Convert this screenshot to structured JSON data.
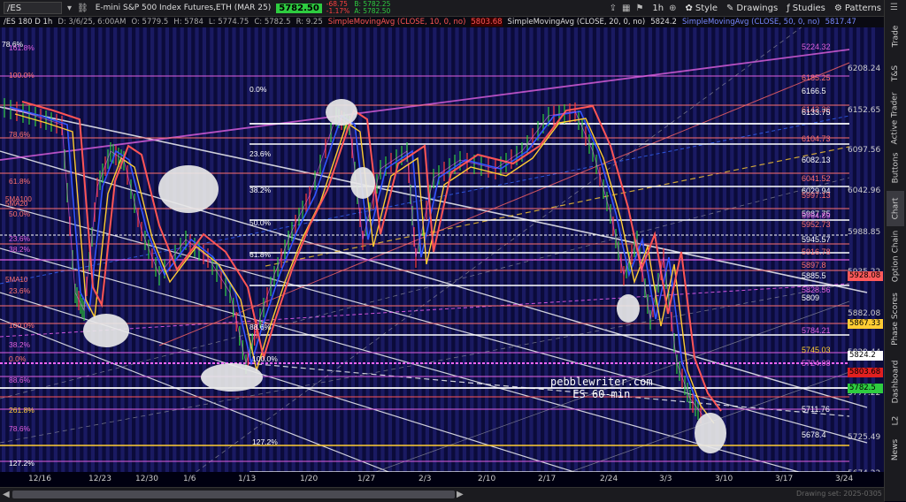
{
  "toolbar": {
    "symbol": "/ES",
    "description": "E-mini S&P 500 Index Futures,ETH (MAR 25)",
    "last_price": "5782.50",
    "change": "-68.75",
    "change_pct": "-1.17%",
    "bid": "B: 5782.25",
    "ask": "A: 5782.50",
    "timeframe": "1h",
    "style_label": "Style",
    "drawings_label": "Drawings",
    "studies_label": "Studies",
    "patterns_label": "Patterns",
    "colors": {
      "price_up": "#2ecc40",
      "change_down": "#ff4040"
    }
  },
  "infobar": {
    "period": "/ES 180 D 1h",
    "date": "D: 3/6/25, 6:00AM",
    "open": "O: 5779.5",
    "high": "H: 5784",
    "low": "L: 5774.75",
    "close": "C: 5782.5",
    "range": "R: 9.25",
    "sma10": "SimpleMovingAvg (CLOSE, 10, 0, no)",
    "sma10_val": "5803.68",
    "sma20": "SimpleMovingAvg (CLOSE, 20, 0, no)",
    "sma20_val": "5824.2",
    "sma50": "SimpleMovingAvg (CLOSE, 50, 0, no)",
    "sma50_val": "5817.47"
  },
  "watermark": {
    "line1": "pebblewriter.com",
    "line2": "ES 60-min"
  },
  "price_axis": [
    "6208.24",
    "6152.65",
    "6097.56",
    "6042.96",
    "5988.85",
    "5935.22",
    "5882.08",
    "5829.44",
    "5777.22",
    "5725.49",
    "5674.22"
  ],
  "x_axis": [
    "12/16",
    "12/23",
    "12/30",
    "1/6",
    "1/13",
    "1/20",
    "1/27",
    "2/3",
    "2/10",
    "2/17",
    "2/24",
    "3/3",
    "3/10",
    "3/17",
    "3/24"
  ],
  "level_labels": [
    {
      "text": "5224.32",
      "color": "#e060e0"
    },
    {
      "text": "6185.25",
      "color": "#ff7070"
    },
    {
      "text": "6166.5",
      "color": "#ffffff"
    },
    {
      "text": "6142.36",
      "color": "#ff7070"
    },
    {
      "text": "6133.75",
      "color": "#ffffff"
    },
    {
      "text": "6104.73",
      "color": "#ff7070"
    },
    {
      "text": "6082.13",
      "color": "#ffffff"
    },
    {
      "text": "6041.52",
      "color": "#ff7070"
    },
    {
      "text": "6029.94",
      "color": "#ffffff"
    },
    {
      "text": "5997.13",
      "color": "#ff7070"
    },
    {
      "text": "5987.75",
      "color": "#ffffff"
    },
    {
      "text": "5964.89",
      "color": "#e060e0"
    },
    {
      "text": "5952.73",
      "color": "#ff7070"
    },
    {
      "text": "5945.57",
      "color": "#ffffff"
    },
    {
      "text": "5916.78",
      "color": "#ff7070"
    },
    {
      "text": "5897.8",
      "color": "#ff7070"
    },
    {
      "text": "5885.5",
      "color": "#ffffff"
    },
    {
      "text": "5828.56",
      "color": "#e060e0"
    },
    {
      "text": "5809",
      "color": "#ffffff"
    },
    {
      "text": "5784.21",
      "color": "#e060e0"
    },
    {
      "text": "5745.03",
      "color": "#ffcc33"
    },
    {
      "text": "5724.08",
      "color": "#e060e0"
    },
    {
      "text": "5711.76",
      "color": "#ffffff"
    },
    {
      "text": "5678.4",
      "color": "#ffffff"
    }
  ],
  "fib_labels": [
    {
      "text": "0.0%",
      "color": "#ffffff"
    },
    {
      "text": "23.6%",
      "color": "#ffffff"
    },
    {
      "text": "38.2%",
      "color": "#ffffff"
    },
    {
      "text": "50.0%",
      "color": "#ffffff"
    },
    {
      "text": "61.8%",
      "color": "#ffffff"
    },
    {
      "text": "78.6%",
      "color": "#ffffff"
    },
    {
      "text": "88.6%",
      "color": "#ffffff"
    },
    {
      "text": "100.0%",
      "color": "#ffffff"
    },
    {
      "text": "127.2%",
      "color": "#ffffff"
    },
    {
      "text": "161.8%",
      "color": "#e060e0"
    },
    {
      "text": "100.0%",
      "color": "#ff7070"
    },
    {
      "text": "78.6%",
      "color": "#ff7070"
    },
    {
      "text": "61.8%",
      "color": "#ff7070"
    },
    {
      "text": "50.0%",
      "color": "#ff7070"
    },
    {
      "text": "23.6%",
      "color": "#e060e0"
    },
    {
      "text": "38.2%",
      "color": "#e060e0"
    },
    {
      "text": "23.6%",
      "color": "#ff7070"
    },
    {
      "text": "100.0%",
      "color": "#ff7070"
    },
    {
      "text": "38.2%",
      "color": "#e060e0"
    },
    {
      "text": "0.0%",
      "color": "#ff7070"
    },
    {
      "text": "88.6%",
      "color": "#e060e0"
    },
    {
      "text": "261.8%",
      "color": "#ffcc33"
    },
    {
      "text": "78.6%",
      "color": "#e060e0"
    },
    {
      "text": "127.2%",
      "color": "#ffffff"
    }
  ],
  "ma_labels": [
    "5MA100",
    "5MA20",
    "5MA10"
  ],
  "right_tags": [
    {
      "text": "5928.08",
      "bg": "#ff5a5a",
      "fg": "#000000"
    },
    {
      "text": "5867.33",
      "bg": "#ffcc33",
      "fg": "#000000"
    },
    {
      "text": "5824.2",
      "bg": "#ffffff",
      "fg": "#000000"
    },
    {
      "text": "5803.68",
      "bg": "#e02020",
      "fg": "#000000"
    },
    {
      "text": "5782.5",
      "bg": "#2ecc40",
      "fg": "#000000"
    }
  ],
  "sidebar": [
    "Trade",
    "T&S",
    "Active Trader",
    "Buttons",
    "Chart",
    "Option Chain",
    "Phase Scores",
    "Dashboard",
    "L2",
    "News"
  ],
  "footer_note": "Drawing set: 2025-0305"
}
